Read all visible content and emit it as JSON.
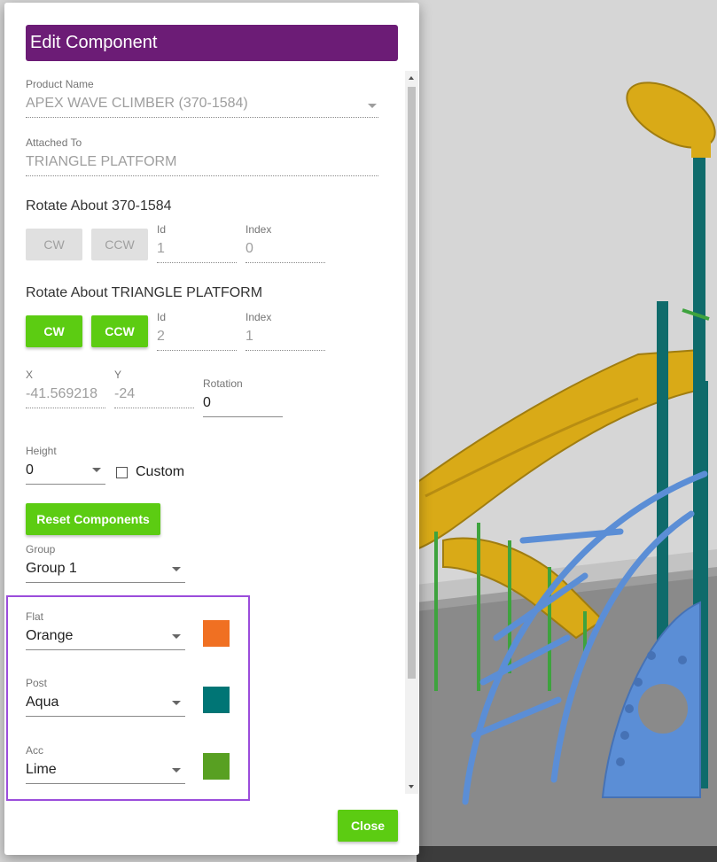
{
  "dialog": {
    "title": "Edit Component",
    "product": {
      "label": "Product Name",
      "value": "APEX WAVE CLIMBER (370-1584)"
    },
    "attached": {
      "label": "Attached To",
      "value": "TRIANGLE PLATFORM"
    },
    "rotate1": {
      "title": "Rotate About 370-1584",
      "cw": "CW",
      "ccw": "CCW",
      "id_label": "Id",
      "id_value": "1",
      "index_label": "Index",
      "index_value": "0"
    },
    "rotate2": {
      "title": "Rotate About TRIANGLE PLATFORM",
      "cw": "CW",
      "ccw": "CCW",
      "id_label": "Id",
      "id_value": "2",
      "index_label": "Index",
      "index_value": "1"
    },
    "position": {
      "x_label": "X",
      "x_value": "-41.569218",
      "y_label": "Y",
      "y_value": "-24",
      "rotation_label": "Rotation",
      "rotation_value": "0"
    },
    "height": {
      "label": "Height",
      "value": "0",
      "custom_label": "Custom",
      "custom_checked": false
    },
    "reset_label": "Reset Components",
    "group": {
      "label": "Group",
      "value": "Group 1"
    },
    "colors": [
      {
        "label": "Flat",
        "value": "Orange",
        "swatch": "#f07022"
      },
      {
        "label": "Post",
        "value": "Aqua",
        "swatch": "#007575"
      },
      {
        "label": "Acc",
        "value": "Lime",
        "swatch": "#58a022"
      }
    ],
    "close_label": "Close"
  },
  "theme": {
    "header_bg": "#6c1c76",
    "accent_green": "#5ccc12",
    "highlight": "#9b4ddb"
  }
}
